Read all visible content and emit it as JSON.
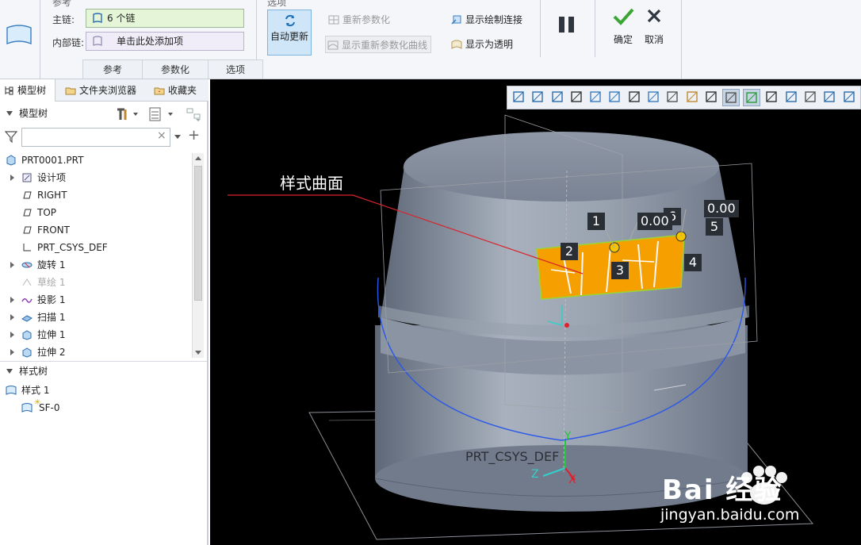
{
  "ribbon": {
    "ref_group_top_label": "参考",
    "options_group_top_label": "选项",
    "main_chain_label": "主链:",
    "main_chain_value": "6 个链",
    "inner_chain_label": "内部链:",
    "inner_chain_value": "单击此处添加项",
    "auto_update": "自动更新",
    "reparam": "重新参数化",
    "show_reparam_curve": "显示重新参数化曲线",
    "show_draw_connect": "显示绘制连接",
    "show_transparent": "显示为透明",
    "confirm": "确定",
    "cancel": "取消",
    "tabs": [
      {
        "label": "参考"
      },
      {
        "label": "参数化"
      },
      {
        "label": "选项"
      }
    ]
  },
  "navtabs": [
    {
      "label": "模型树"
    },
    {
      "label": "文件夹浏览器"
    },
    {
      "label": "收藏夹"
    }
  ],
  "model_tree": {
    "header": "模型树",
    "root": "PRT0001.PRT",
    "items": [
      {
        "label": "设计项",
        "expandable": true,
        "dim": false,
        "icon": "design-items-icon"
      },
      {
        "label": "RIGHT",
        "expandable": false,
        "dim": false,
        "icon": "datum-plane-icon"
      },
      {
        "label": "TOP",
        "expandable": false,
        "dim": false,
        "icon": "datum-plane-icon"
      },
      {
        "label": "FRONT",
        "expandable": false,
        "dim": false,
        "icon": "datum-plane-icon"
      },
      {
        "label": "PRT_CSYS_DEF",
        "expandable": false,
        "dim": false,
        "icon": "csys-icon"
      },
      {
        "label": "旋转 1",
        "expandable": true,
        "dim": false,
        "icon": "revolve-icon"
      },
      {
        "label": "草绘 1",
        "expandable": false,
        "dim": true,
        "icon": "sketch-icon"
      },
      {
        "label": "投影 1",
        "expandable": true,
        "dim": false,
        "icon": "projection-icon"
      },
      {
        "label": "扫描 1",
        "expandable": true,
        "dim": false,
        "icon": "sweep-icon"
      },
      {
        "label": "拉伸 1",
        "expandable": true,
        "dim": false,
        "icon": "extrude-icon"
      },
      {
        "label": "拉伸 2",
        "expandable": true,
        "dim": false,
        "icon": "extrude-icon"
      }
    ]
  },
  "style_tree": {
    "header": "样式树",
    "root": "样式 1",
    "child": "SF-0"
  },
  "viewport": {
    "annotation": "样式曲面",
    "tags": [
      "1",
      "2",
      "3",
      "4",
      "5",
      "6"
    ],
    "values": [
      "0.00",
      "0.00"
    ],
    "csys_label": "PRT_CSYS_DEF",
    "watermark_text": "Bai 经验",
    "watermark_url": "jingyan.baidu.com",
    "graphics_toolbar_icons": [
      "refit-icon",
      "zoom-in-icon",
      "zoom-out-icon",
      "repaint-icon",
      "display-style-icon",
      "saved-views-icon",
      "view-manager-icon",
      "perspective-icon",
      "section-icon",
      "datum-display-icon",
      "annotation-display-icon",
      "spin-center-icon",
      "curve-connections-icon",
      "control-points-icon",
      "plane-grid-icon",
      "snap-icon",
      "layout-icon",
      "more-icon"
    ]
  },
  "colors": {
    "viewport_bg": "#000000",
    "body_shade": "#8a93a2",
    "surface_fill": "#f5a000",
    "curve_blue": "#2b58e8",
    "active_cmd_bg": "#cfe6f8"
  }
}
